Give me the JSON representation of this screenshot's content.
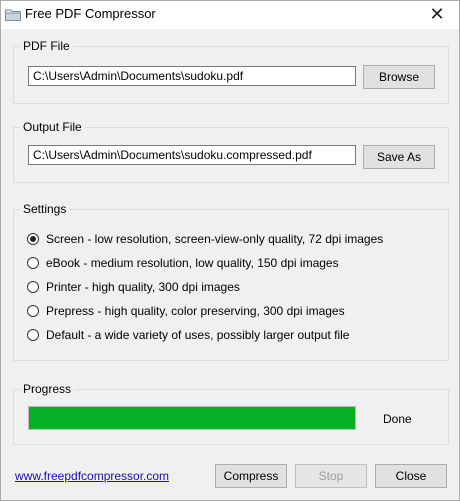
{
  "window": {
    "title": "Free PDF Compressor",
    "close_glyph": "✕"
  },
  "pdf_file": {
    "group_label": "PDF File",
    "path": "C:\\Users\\Admin\\Documents\\sudoku.pdf",
    "browse_label": "Browse"
  },
  "output_file": {
    "group_label": "Output File",
    "path": "C:\\Users\\Admin\\Documents\\sudoku.compressed.pdf",
    "save_as_label": "Save As"
  },
  "settings": {
    "group_label": "Settings",
    "options": [
      {
        "label": "Screen - low resolution, screen-view-only quality, 72 dpi images",
        "checked": true
      },
      {
        "label": "eBook - medium resolution, low quality, 150 dpi images",
        "checked": false
      },
      {
        "label": "Printer - high quality, 300 dpi images",
        "checked": false
      },
      {
        "label": "Prepress - high quality, color preserving, 300 dpi images",
        "checked": false
      },
      {
        "label": "Default - a wide variety of uses, possibly larger output file",
        "checked": false
      }
    ]
  },
  "progress": {
    "group_label": "Progress",
    "fraction": 1.0,
    "status": "Done",
    "bar_color": "#06b025"
  },
  "footer": {
    "link_text": "www.freepdfcompressor.com",
    "compress_label": "Compress",
    "stop_label": "Stop",
    "stop_enabled": false,
    "close_label": "Close"
  }
}
